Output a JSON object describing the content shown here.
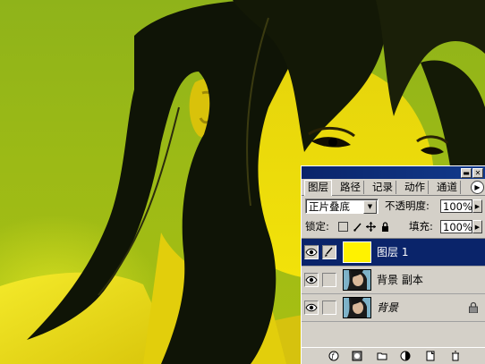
{
  "canvas": {
    "subject": "photo of a woman with long dark hair on yellow-green background",
    "background_color": "#9cba16",
    "hair_color": "#0f1406",
    "skin_color": "#e7d20a"
  },
  "layers_panel": {
    "tabs": [
      {
        "label": "图层",
        "active": true
      },
      {
        "label": "路径",
        "active": false
      },
      {
        "label": "记录",
        "active": false
      },
      {
        "label": "动作",
        "active": false
      },
      {
        "label": "通道",
        "active": false
      }
    ],
    "blend_mode": "正片叠底",
    "opacity_label": "不透明度:",
    "opacity_value": "100%",
    "lock_label": "锁定:",
    "fill_label": "填充:",
    "fill_value": "100%",
    "layers": [
      {
        "name": "图层 1",
        "selected": true,
        "thumbnail": "yellow-fill",
        "locked": false
      },
      {
        "name": "背景 副本",
        "selected": false,
        "thumbnail": "photo",
        "locked": false
      },
      {
        "name": "背景",
        "selected": false,
        "thumbnail": "photo",
        "locked": true
      }
    ],
    "colors": {
      "panel_bg": "#d4d0c8",
      "selection": "#0a246a",
      "yellow_fill": "#fff200"
    },
    "icons": {
      "visibility": "eye-icon",
      "brush": "brush-icon",
      "lock": "lock-icon",
      "menu": "panel-menu-icon"
    }
  }
}
